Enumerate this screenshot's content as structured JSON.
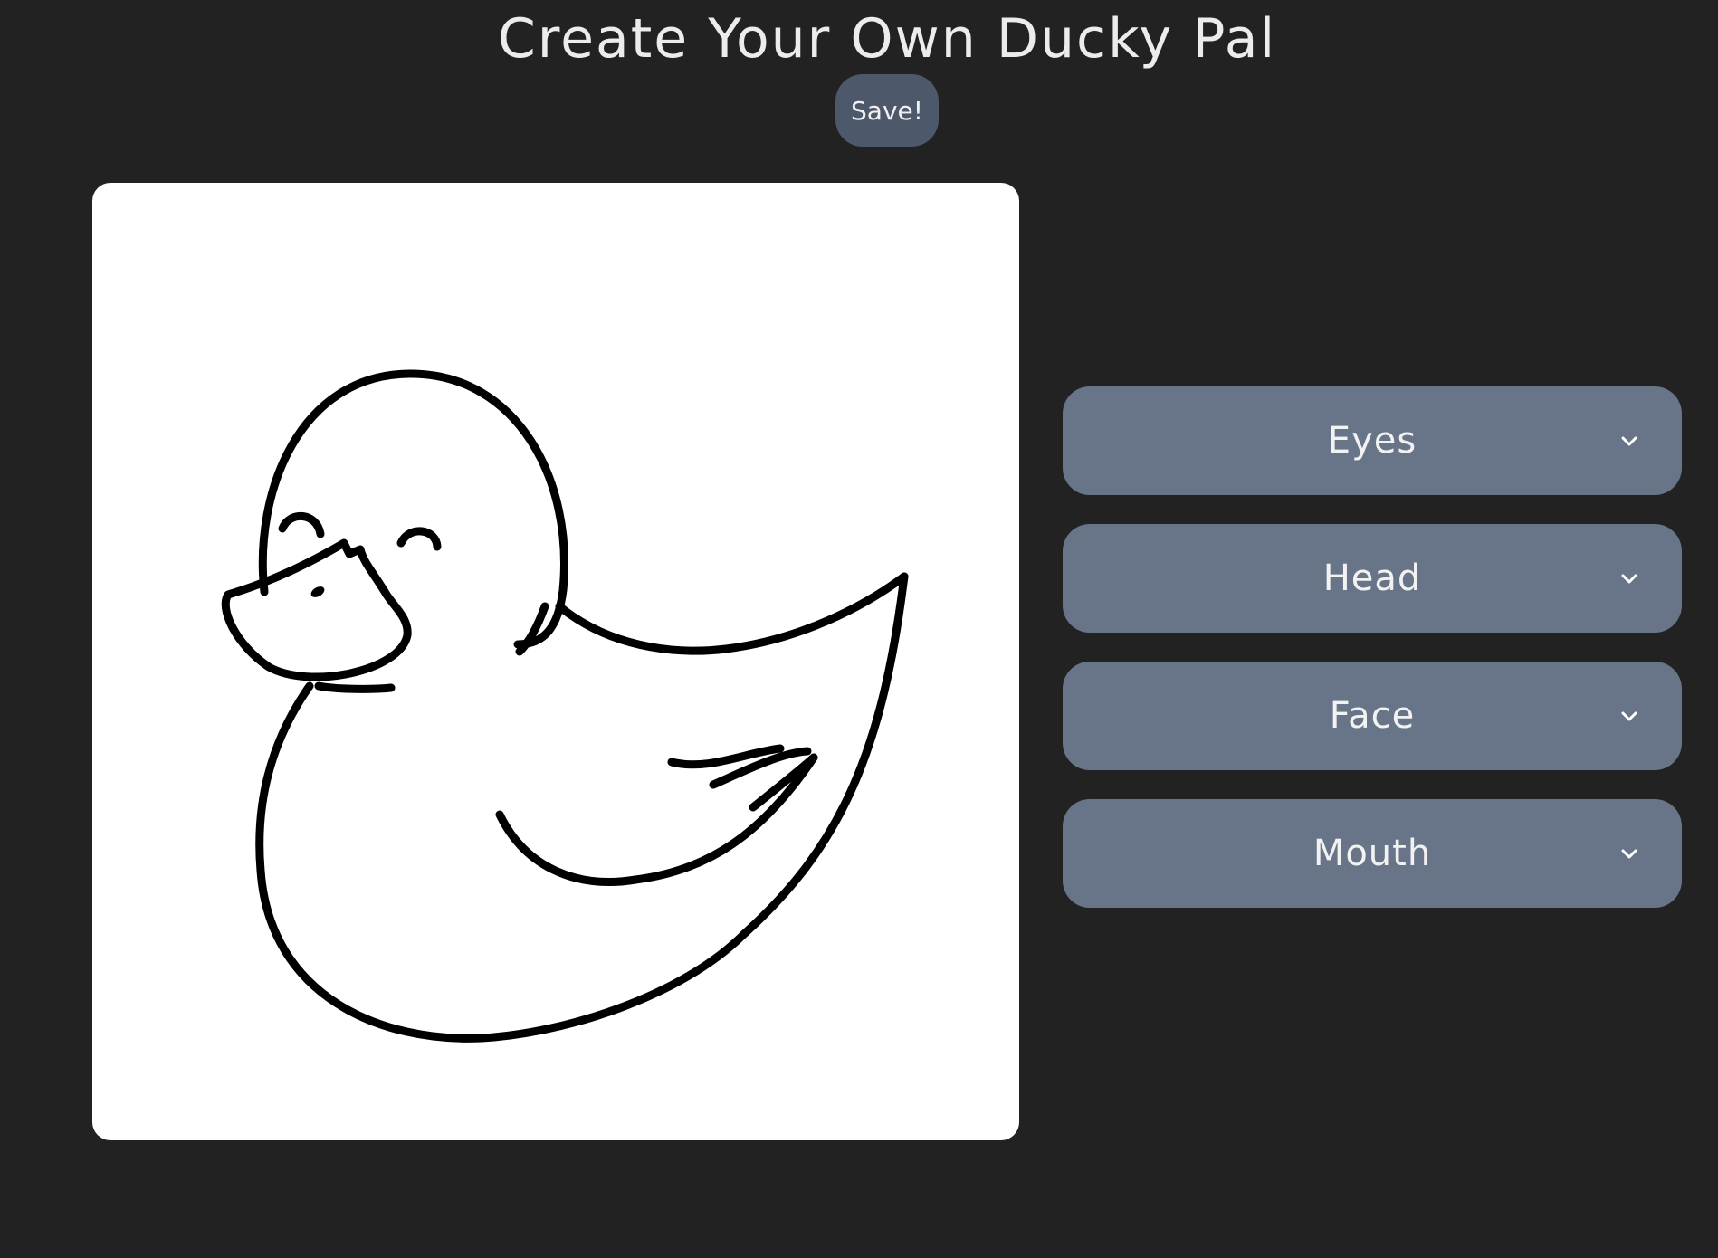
{
  "header": {
    "title": "Create Your Own Ducky Pal",
    "save_label": "Save!"
  },
  "dropdowns": [
    {
      "label": "Eyes",
      "icon": "chevron-down-icon"
    },
    {
      "label": "Head",
      "icon": "chevron-down-icon"
    },
    {
      "label": "Face",
      "icon": "chevron-down-icon"
    },
    {
      "label": "Mouth",
      "icon": "chevron-down-icon"
    }
  ],
  "colors": {
    "background": "#222222",
    "button": "#4e586b",
    "dropdown": "#687589",
    "canvas": "#ffffff",
    "outline": "#000000"
  }
}
